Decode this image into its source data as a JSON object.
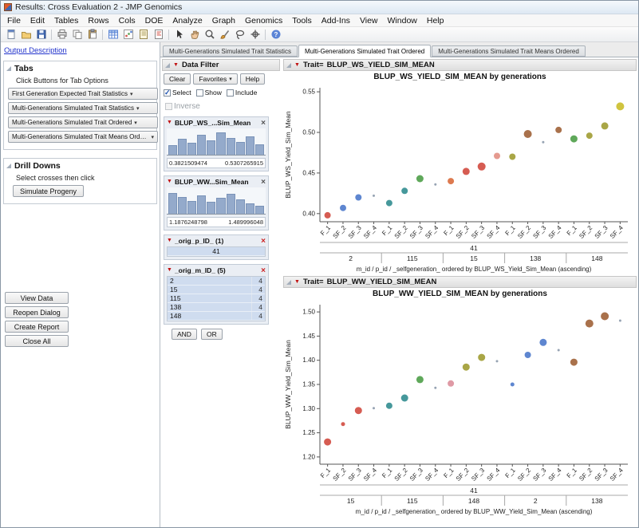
{
  "window": {
    "title": "Results: Cross Evaluation 2 - JMP Genomics"
  },
  "menu_bar": {
    "items": [
      "File",
      "Edit",
      "Tables",
      "Rows",
      "Cols",
      "DOE",
      "Analyze",
      "Graph",
      "Genomics",
      "Tools",
      "Add-Ins",
      "View",
      "Window",
      "Help"
    ]
  },
  "toolbar": {
    "icons": [
      {
        "name": "new-journal-icon"
      },
      {
        "name": "open-folder-icon"
      },
      {
        "name": "save-icon"
      },
      {
        "name": "print-icon",
        "sep": true
      },
      {
        "name": "copy-icon"
      },
      {
        "name": "paste-icon"
      },
      {
        "name": "data-table-icon",
        "sep": true
      },
      {
        "name": "graph-icon"
      },
      {
        "name": "journal-icon"
      },
      {
        "name": "script-icon"
      },
      {
        "name": "arrow-tool-icon",
        "sep": true
      },
      {
        "name": "hand-tool-icon"
      },
      {
        "name": "zoom-icon"
      },
      {
        "name": "brush-icon"
      },
      {
        "name": "lasso-icon"
      },
      {
        "name": "crosshair-icon"
      },
      {
        "name": "help-icon",
        "sep": true
      }
    ]
  },
  "sidebar": {
    "output_description_link": "Output Description",
    "tabs_box": {
      "title": "Tabs",
      "hint": "Click Buttons for Tab Options",
      "buttons": [
        {
          "label": "First Generation Expected Trait Statistics"
        },
        {
          "label": "Multi-Generations Simulated Trait Statistics"
        },
        {
          "label": "Multi-Generations Simulated Trait Ordered"
        },
        {
          "label": "Multi-Generations Simulated Trait Means Ordered"
        }
      ]
    },
    "drill_downs_box": {
      "title": "Drill Downs",
      "hint": "Select crosses then click",
      "buttons": [
        {
          "label": "Simulate Progeny"
        }
      ]
    },
    "action_buttons": [
      {
        "label": "View Data"
      },
      {
        "label": "Reopen Dialog"
      },
      {
        "label": "Create Report"
      },
      {
        "label": "Close All"
      }
    ]
  },
  "tab_strip": {
    "tabs": [
      {
        "label": "Multi-Generations Simulated Trait Statistics",
        "active": false
      },
      {
        "label": "Multi-Generations Simulated Trait Ordered",
        "active": true
      },
      {
        "label": "Multi-Generations Simulated Trait Means Ordered",
        "active": false
      }
    ]
  },
  "data_filter": {
    "title": "Data Filter",
    "buttons": [
      {
        "label": "Clear"
      },
      {
        "label": "Favorites",
        "has_arrow": true
      },
      {
        "label": "Help"
      }
    ],
    "mode_checkboxes": [
      {
        "label": "Select",
        "checked": true
      },
      {
        "label": "Show",
        "checked": false
      },
      {
        "label": "Include",
        "checked": false
      }
    ],
    "inverse_checkbox": {
      "label": "Inverse",
      "checked": false,
      "disabled": true
    },
    "filters": [
      {
        "name": "BLUP_WS_...Sim_Mean",
        "kind": "histogram",
        "min_label": "0.3821509474",
        "max_label": "0.5307265915",
        "bars": [
          35,
          60,
          45,
          75,
          55,
          85,
          65,
          50,
          70,
          40
        ],
        "close_red": false
      },
      {
        "name": "BLUP_WW...Sim_Mean",
        "kind": "histogram",
        "min_label": "1.1876248798",
        "max_label": "1.489996048",
        "bars": [
          80,
          65,
          50,
          70,
          45,
          60,
          75,
          55,
          40,
          30
        ],
        "close_red": false
      },
      {
        "name": "_orig_p_ID_ (1)",
        "kind": "list",
        "close_red": true,
        "rows": [
          {
            "value": "41",
            "count": ""
          }
        ]
      },
      {
        "name": "_orig_m_ID_ (5)",
        "kind": "list",
        "close_red": true,
        "rows": [
          {
            "value": "2",
            "count": "4"
          },
          {
            "value": "15",
            "count": "4"
          },
          {
            "value": "115",
            "count": "4"
          },
          {
            "value": "138",
            "count": "4"
          },
          {
            "value": "148",
            "count": "4"
          }
        ]
      }
    ],
    "logic_buttons": [
      {
        "label": "AND"
      },
      {
        "label": "OR"
      }
    ]
  },
  "chart_data": [
    {
      "type": "scatter",
      "header_prefix": "Trait=",
      "header_value": "BLUP_WS_YIELD_SIM_MEAN",
      "title": "BLUP_WS_YIELD_SIM_MEAN by generations",
      "ylabel": "BLUP_WS_Yield_Sim_Mean",
      "xlabel": "m_id / p_id / _selfgeneration_ ordered by BLUP_WS_Yield_Sim_Mean (ascending)",
      "ymin": 0.39,
      "ymax": 0.555,
      "yticks": [
        {
          "v": 0.4,
          "label": "0.40"
        },
        {
          "v": 0.45,
          "label": "0.45"
        },
        {
          "v": 0.5,
          "label": "0.50"
        },
        {
          "v": 0.55,
          "label": "0.55"
        }
      ],
      "p_label": "41",
      "groups": [
        "2",
        "115",
        "15",
        "138",
        "148"
      ],
      "gen_labels": [
        "F_1",
        "SF_2",
        "SF_3",
        "SF_4"
      ],
      "points": [
        {
          "y": 0.398,
          "color": "#d65c52",
          "r": 4
        },
        {
          "y": 0.407,
          "color": "#5e86d0",
          "r": 4
        },
        {
          "y": 0.42,
          "color": "#5e86d0",
          "r": 4
        },
        {
          "y": 0.422,
          "color": "#96a3b3",
          "r": 1.5
        },
        {
          "y": 0.413,
          "color": "#46989b",
          "r": 4
        },
        {
          "y": 0.428,
          "color": "#46989b",
          "r": 4
        },
        {
          "y": 0.443,
          "color": "#5fa85a",
          "r": 4.5
        },
        {
          "y": 0.436,
          "color": "#96a3b3",
          "r": 1.5
        },
        {
          "y": 0.44,
          "color": "#dd7a4f",
          "r": 4
        },
        {
          "y": 0.452,
          "color": "#d65c52",
          "r": 4.5
        },
        {
          "y": 0.458,
          "color": "#d65c52",
          "r": 5
        },
        {
          "y": 0.471,
          "color": "#e59a8f",
          "r": 4
        },
        {
          "y": 0.47,
          "color": "#a9a646",
          "r": 4
        },
        {
          "y": 0.498,
          "color": "#a9714b",
          "r": 5
        },
        {
          "y": 0.488,
          "color": "#96a3b3",
          "r": 1.5
        },
        {
          "y": 0.503,
          "color": "#a9714b",
          "r": 4
        },
        {
          "y": 0.492,
          "color": "#5fa85a",
          "r": 4.5
        },
        {
          "y": 0.496,
          "color": "#a9a646",
          "r": 4
        },
        {
          "y": 0.508,
          "color": "#a9a646",
          "r": 4.5
        },
        {
          "y": 0.532,
          "color": "#d0c43f",
          "r": 5
        }
      ]
    },
    {
      "type": "scatter",
      "header_prefix": "Trait=",
      "header_value": "BLUP_WW_YIELD_SIM_MEAN",
      "title": "BLUP_WW_YIELD_SIM_MEAN by generations",
      "ylabel": "BLUP_WW_Yield_Sim_Mean",
      "xlabel": "m_id / p_id / _selfgeneration_ ordered by BLUP_WW_Yield_Sim_Mean (ascending)",
      "ymin": 1.185,
      "ymax": 1.515,
      "yticks": [
        {
          "v": 1.2,
          "label": "1.20"
        },
        {
          "v": 1.25,
          "label": "1.25"
        },
        {
          "v": 1.3,
          "label": "1.30"
        },
        {
          "v": 1.35,
          "label": "1.35"
        },
        {
          "v": 1.4,
          "label": "1.40"
        },
        {
          "v": 1.45,
          "label": "1.45"
        },
        {
          "v": 1.5,
          "label": "1.50"
        }
      ],
      "p_label": "41",
      "groups": [
        "15",
        "115",
        "148",
        "2",
        "138"
      ],
      "gen_labels": [
        "F_1",
        "SF_2",
        "SF_3",
        "SF_4"
      ],
      "points": [
        {
          "y": 1.231,
          "color": "#d65c52",
          "r": 4.5
        },
        {
          "y": 1.268,
          "color": "#d65c52",
          "r": 2.5
        },
        {
          "y": 1.296,
          "color": "#d65c52",
          "r": 4.5
        },
        {
          "y": 1.301,
          "color": "#96a3b3",
          "r": 1.5
        },
        {
          "y": 1.306,
          "color": "#46989b",
          "r": 4
        },
        {
          "y": 1.322,
          "color": "#46989b",
          "r": 4.5
        },
        {
          "y": 1.36,
          "color": "#5fa85a",
          "r": 4.5
        },
        {
          "y": 1.343,
          "color": "#96a3b3",
          "r": 1.5
        },
        {
          "y": 1.352,
          "color": "#df9aa5",
          "r": 4
        },
        {
          "y": 1.386,
          "color": "#a9a646",
          "r": 4.5
        },
        {
          "y": 1.406,
          "color": "#a9a646",
          "r": 4.5
        },
        {
          "y": 1.398,
          "color": "#96a3b3",
          "r": 1.5
        },
        {
          "y": 1.35,
          "color": "#5e86d0",
          "r": 2.5
        },
        {
          "y": 1.411,
          "color": "#5e86d0",
          "r": 4
        },
        {
          "y": 1.437,
          "color": "#5e86d0",
          "r": 4.5
        },
        {
          "y": 1.421,
          "color": "#96a3b3",
          "r": 1.5
        },
        {
          "y": 1.396,
          "color": "#a9714b",
          "r": 4.5
        },
        {
          "y": 1.476,
          "color": "#a9714b",
          "r": 5
        },
        {
          "y": 1.491,
          "color": "#a9714b",
          "r": 5
        },
        {
          "y": 1.482,
          "color": "#96a3b3",
          "r": 1.5
        }
      ]
    }
  ]
}
